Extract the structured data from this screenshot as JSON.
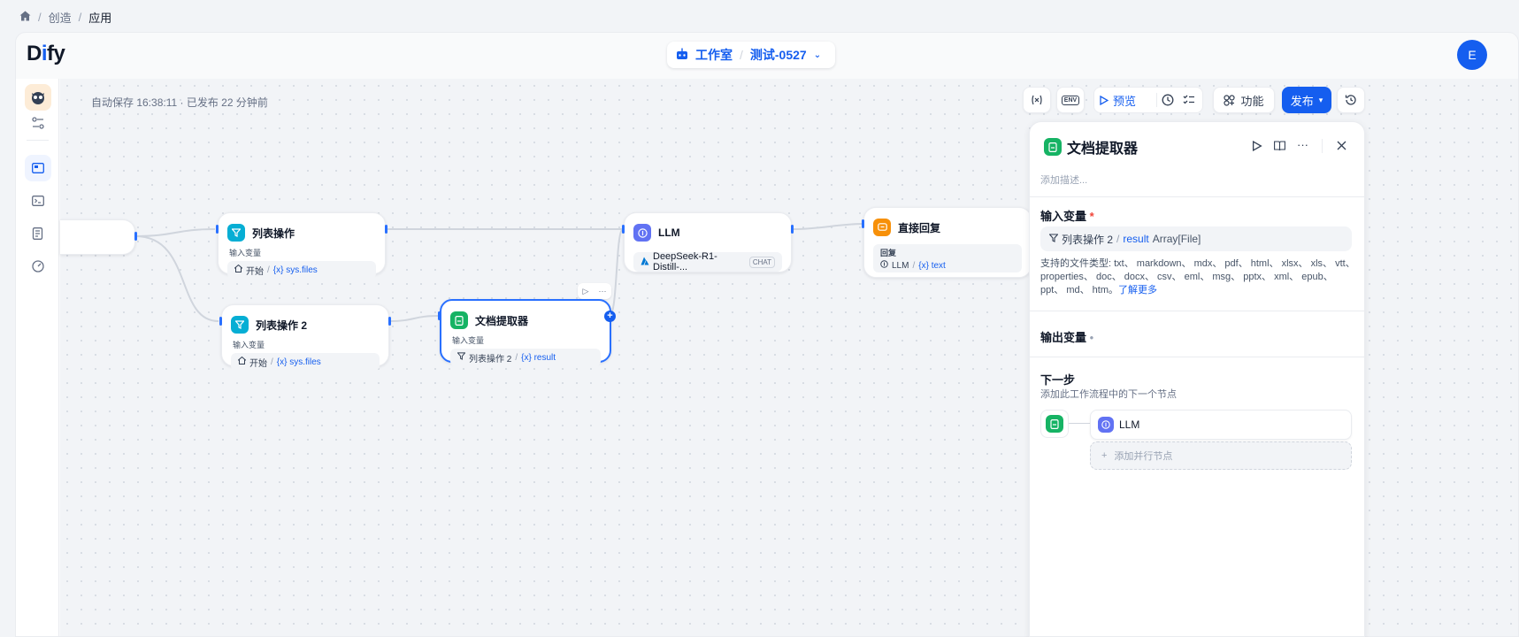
{
  "breadcrumb": {
    "home_icon": "home-icon",
    "items": [
      "创造",
      "应用"
    ],
    "sep": "/"
  },
  "app": {
    "logo_pre": "D",
    "logo_i": "i",
    "logo_post": "fy",
    "workspace": "工作室",
    "app_name": "测试-0527",
    "switch_sep": "/",
    "avatar": "E"
  },
  "toolbar": {
    "autosave": "自动保存 16:38:11 · 已发布 22 分钟前",
    "env_label": "ENV",
    "preview": "预览",
    "features": "功能",
    "publish": "发布"
  },
  "nodes": {
    "start": {
      "title": ""
    },
    "list1": {
      "title": "列表操作",
      "label": "输入变量",
      "src": "开始",
      "sep": "/",
      "var": "{x} sys.files"
    },
    "list2": {
      "title": "列表操作 2",
      "label": "输入变量",
      "src": "开始",
      "sep": "/",
      "var": "{x} sys.files"
    },
    "doc": {
      "title": "文档提取器",
      "label": "输入变量",
      "src": "列表操作 2",
      "sep": "/",
      "var": "{x} result"
    },
    "llm": {
      "title": "LLM",
      "model": "DeepSeek-R1-Distill-...",
      "tag": "CHAT"
    },
    "answer": {
      "title": "直接回复",
      "label": "回复",
      "src": "LLM",
      "sep": "/",
      "var": "{x} text"
    }
  },
  "panel": {
    "title": "文档提取器",
    "desc_placeholder": "添加描述...",
    "input_title": "输入变量",
    "required": "*",
    "input_src": "列表操作 2",
    "input_sep": "/",
    "input_var": "result",
    "input_type": "Array[File]",
    "supported": "支持的文件类型: txt、 markdown、 mdx、 pdf、 html、 xlsx、 xls、 vtt、 properties、 doc、 docx、 csv、 eml、 msg、 pptx、 xml、 epub、 ppt、 md、 htm。",
    "learn_more": "了解更多",
    "output_title": "输出变量",
    "next_title": "下一步",
    "next_desc": "添加此工作流程中的下一个节点",
    "next_node": "LLM",
    "add_parallel": "添加并行节点",
    "plus": "+"
  },
  "colors": {
    "accent": "#155eef",
    "list": "#06aed4",
    "doc": "#16b364",
    "llm": "#6172f3",
    "answer": "#f79009"
  }
}
